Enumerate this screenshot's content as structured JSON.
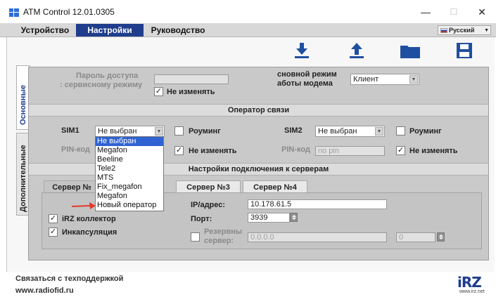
{
  "window": {
    "title": "ATM Control 12.01.0305",
    "minimize": "—",
    "maximize": "☐",
    "close": "✕"
  },
  "menu": {
    "tabs": [
      {
        "label": "Устройство"
      },
      {
        "label": "Настройки"
      },
      {
        "label": "Руководство"
      }
    ],
    "language": "Русский"
  },
  "toolbar": {
    "icons": [
      "download-icon",
      "upload-icon",
      "folder-icon",
      "save-icon"
    ]
  },
  "side_tabs": {
    "basic": "Основные",
    "additional": "Дополнительные"
  },
  "access": {
    "password_label_1": "Пароль доступа",
    "password_label_2": ": сервисному режиму",
    "no_change": "Не изменять",
    "mode_label_1": "сновной режим",
    "mode_label_2": "аботы модема",
    "mode_value": "Клиент"
  },
  "operator": {
    "header": "Оператор связи",
    "sim1_label": "SIM1",
    "sim1_value": "Не выбран",
    "roaming": "Роуминг",
    "sim2_label": "SIM2",
    "sim2_value": "Не выбран",
    "pin_label": "PIN-код",
    "pin_placeholder": "no pin",
    "no_change": "Не изменять"
  },
  "server_settings": {
    "header": "Настройки подключения к серверам",
    "tabs": [
      "Сервер №",
      "Сервер №3",
      "Сервер №4"
    ],
    "ip_label": "IP/адрес:",
    "ip_value": "10.178.61.5",
    "port_label": "Порт:",
    "port_value": "3939",
    "irz_collector": "iRZ коллектор",
    "encapsulation": "Инкапсуляция",
    "reserve_label_1": "Резервны",
    "reserve_label_2": "сервер:",
    "reserve_ip": "0.0.0.0",
    "reserve_port": "0"
  },
  "dropdown": {
    "items": [
      "Не выбран",
      "Megafon",
      "Beeline",
      "Tele2",
      "MTS",
      "Fix_megafon",
      "Megafon",
      "Новый оператор"
    ],
    "selected_index": 0
  },
  "footer": {
    "support": "Связаться с техподдержкой",
    "website": "www.radiofid.ru",
    "logo_text": "iRZ",
    "logo_url": "www.irz.net"
  },
  "colors": {
    "menu_active": "#1f3d8c",
    "dropdown_selected": "#2f63d2",
    "icon_blue": "#1f4fa0",
    "annotation_arrow": "#e23a2a"
  }
}
